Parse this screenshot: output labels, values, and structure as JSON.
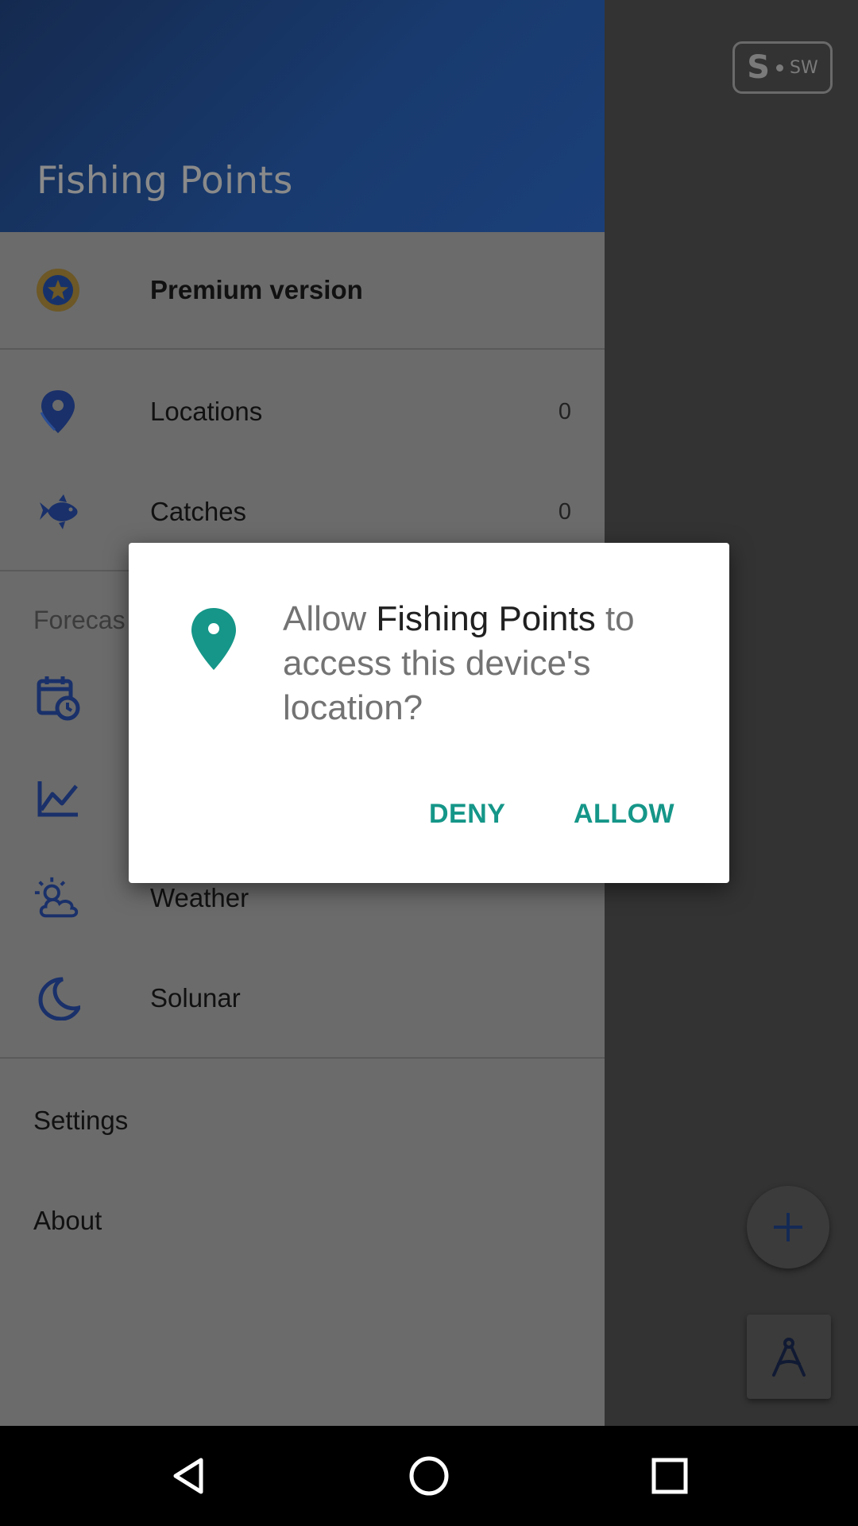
{
  "app": {
    "title": "Fishing Points"
  },
  "map": {
    "logo": {
      "big": "S",
      "small": "SW"
    },
    "icons": {
      "add": "plus-icon",
      "compass": "compass-icon"
    }
  },
  "drawer": {
    "premium": {
      "label": "Premium version",
      "icon": "star-icon"
    },
    "locations": {
      "label": "Locations",
      "count": "0",
      "icon": "location-pin-icon"
    },
    "catches": {
      "label": "Catches",
      "count": "0",
      "icon": "fish-icon"
    },
    "forecast_section": "Forecas",
    "weather": {
      "label": "Weather",
      "icon": "weather-icon"
    },
    "solunar": {
      "label": "Solunar",
      "icon": "moon-icon"
    },
    "settings": "Settings",
    "about": "About"
  },
  "dialog": {
    "message_prefix": "Allow ",
    "app_name": "Fishing Points",
    "message_suffix": " to access this device's location?",
    "deny": "DENY",
    "allow": "ALLOW",
    "icon": "location-pin-icon"
  },
  "colors": {
    "drawer_header": "#183a6e",
    "accent": "#159688",
    "icon_blue": "#19306a"
  },
  "nav": {
    "back": "back-icon",
    "home": "home-icon",
    "recents": "recents-icon"
  }
}
